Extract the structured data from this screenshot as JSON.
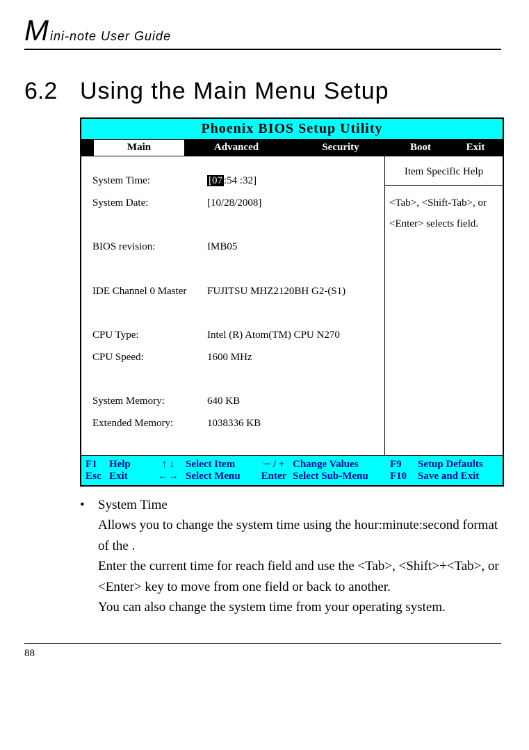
{
  "header": {
    "initial": "M",
    "rest": "ini-note User Guide"
  },
  "section": {
    "num": "6.2",
    "title": "Using the Main Menu Setup"
  },
  "bios": {
    "title": "Phoenix BIOS Setup Utility",
    "tabs": {
      "main": "Main",
      "advanced": "Advanced",
      "security": "Security",
      "boot": "Boot",
      "exit": "Exit"
    },
    "help": {
      "title": "Item Specific Help",
      "text": "<Tab>, <Shift-Tab>, or <Enter> selects field."
    },
    "fields": {
      "systemTimeLabel": "System Time:",
      "systemTimeHour": "[07",
      "systemTimeRest": ":54 :32]",
      "systemDateLabel": "System Date:",
      "systemDate": "[10/28/2008]",
      "biosRevLabel": "BIOS revision:",
      "biosRev": "IMB05",
      "ideLabel": "IDE Channel 0 Master",
      "ide": "FUJITSU MHZ2120BH G2-(S1)",
      "cpuTypeLabel": "CPU Type:",
      "cpuType": "Intel (R) Atom(TM) CPU N270",
      "cpuSpeedLabel": "CPU Speed:",
      "cpuSpeed": "1600 MHz",
      "sysMemLabel": "System Memory:",
      "sysMem": "640 KB",
      "extMemLabel": "Extended Memory:",
      "extMem": "1038336 KB"
    },
    "footer": {
      "r1": {
        "k1": "F1",
        "k2": "Help",
        "k3": "↑ ↓",
        "k4": "Select Item",
        "k5": "─ / +",
        "k6": "Change Values",
        "k7": "F9",
        "k8": "Setup Defaults"
      },
      "r2": {
        "k1": "Esc",
        "k2": "Exit",
        "k3": "←→",
        "k4": "Select Menu",
        "k5": "Enter",
        "k6": "Select Sub-Menu",
        "k7": "F10",
        "k8": "Save and Exit"
      }
    }
  },
  "body": {
    "bulletTitle": "System Time",
    "p1": "Allows you to change the system time using the hour:minute:second format of the .",
    "p2": "Enter the current time for reach field and use the <Tab>, <Shift>+<Tab>, or <Enter> key to move from one field or back to another.",
    "p3": "You can also change the system time from your operating system."
  },
  "pageNumber": "88"
}
